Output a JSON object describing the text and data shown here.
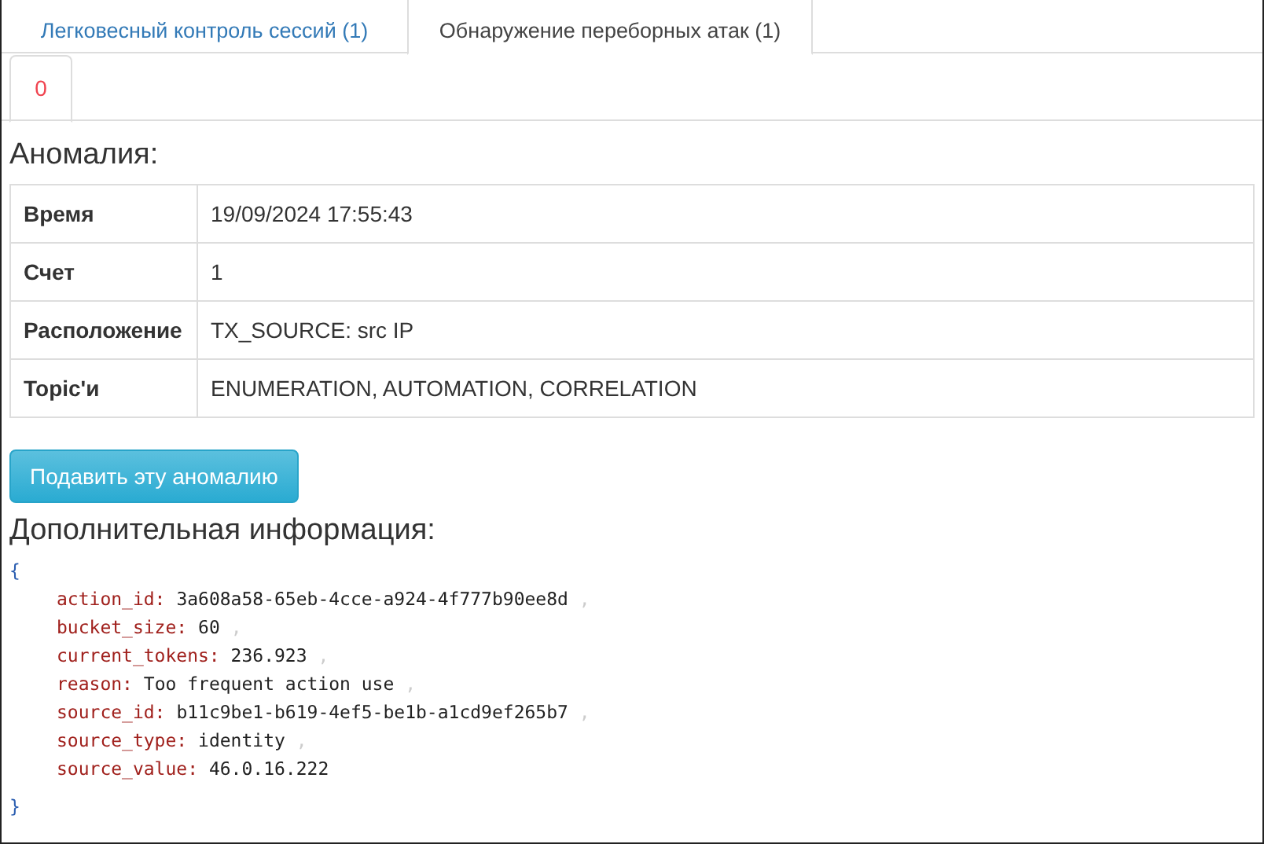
{
  "tabs": [
    {
      "label": "Легковесный контроль сессий (1)",
      "selected": false
    },
    {
      "label": "Обнаружение переборных атак (1)",
      "selected": true
    }
  ],
  "subtabs": [
    {
      "label": "0",
      "selected": true
    }
  ],
  "anomaly": {
    "title": "Аномалия:",
    "rows": [
      {
        "label": "Время",
        "value": "19/09/2024 17:55:43"
      },
      {
        "label": "Счет",
        "value": "1"
      },
      {
        "label": "Расположение",
        "value": "TX_SOURCE: src IP"
      },
      {
        "label": "Topic'и",
        "value": "ENUMERATION, AUTOMATION, CORRELATION"
      }
    ]
  },
  "suppress_button": "Подавить эту аномалию",
  "extra": {
    "title": "Дополнительная информация:",
    "open_brace": "{",
    "close_brace": "}",
    "entries": [
      {
        "key": "action_id:",
        "value": "3a608a58-65eb-4cce-a924-4f777b90ee8d",
        "separator": ","
      },
      {
        "key": "bucket_size:",
        "value": "60",
        "separator": ","
      },
      {
        "key": "current_tokens:",
        "value": "236.923",
        "separator": ","
      },
      {
        "key": "reason:",
        "value": "Too frequent action use",
        "separator": ","
      },
      {
        "key": "source_id:",
        "value": "b11c9be1-b619-4ef5-be1b-a1cd9ef265b7",
        "separator": ","
      },
      {
        "key": "source_type:",
        "value": "identity",
        "separator": ","
      },
      {
        "key": "source_value:",
        "value": "46.0.16.222"
      }
    ]
  }
}
